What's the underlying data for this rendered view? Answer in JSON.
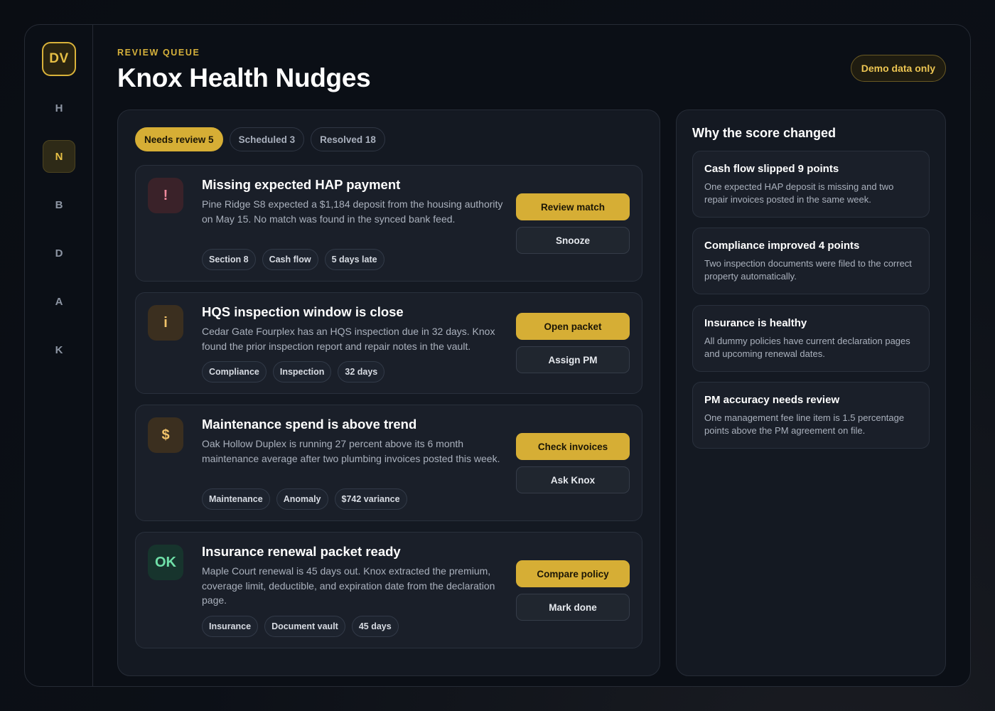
{
  "sidebar": {
    "logo": "DV",
    "items": [
      {
        "label": "H",
        "active": false
      },
      {
        "label": "N",
        "active": true
      },
      {
        "label": "B",
        "active": false
      },
      {
        "label": "D",
        "active": false
      },
      {
        "label": "A",
        "active": false
      },
      {
        "label": "K",
        "active": false
      }
    ]
  },
  "header": {
    "eyebrow": "REVIEW QUEUE",
    "title": "Knox Health Nudges",
    "badge": "Demo data only"
  },
  "tabs": [
    {
      "label": "Needs review 5",
      "active": true
    },
    {
      "label": "Scheduled 3",
      "active": false
    },
    {
      "label": "Resolved 18",
      "active": false
    }
  ],
  "nudges": [
    {
      "icon": "!",
      "icon_name": "alert-icon",
      "title": "Missing expected HAP payment",
      "body": "Pine Ridge S8 expected a $1,184 deposit from the housing authority on May 15. No match was found in the synced bank feed.",
      "tags": [
        "Section 8",
        "Cash flow",
        "5 days late"
      ],
      "primary": "Review match",
      "secondary": "Snooze"
    },
    {
      "icon": "i",
      "icon_name": "info-icon",
      "title": "HQS inspection window is close",
      "body": "Cedar Gate Fourplex has an HQS inspection due in 32 days. Knox found the prior inspection report and repair notes in the vault.",
      "tags": [
        "Compliance",
        "Inspection",
        "32 days"
      ],
      "primary": "Open packet",
      "secondary": "Assign PM"
    },
    {
      "icon": "$",
      "icon_name": "dollar-icon",
      "title": "Maintenance spend is above trend",
      "body": "Oak Hollow Duplex is running 27 percent above its 6 month maintenance average after two plumbing invoices posted this week.",
      "tags": [
        "Maintenance",
        "Anomaly",
        "$742 variance"
      ],
      "primary": "Check invoices",
      "secondary": "Ask Knox"
    },
    {
      "icon": "OK",
      "icon_name": "ok-icon",
      "title": "Insurance renewal packet ready",
      "body": "Maple Court renewal is 45 days out. Knox extracted the premium, coverage limit, deductible, and expiration date from the declaration page.",
      "tags": [
        "Insurance",
        "Document vault",
        "45 days"
      ],
      "primary": "Compare policy",
      "secondary": "Mark done"
    }
  ],
  "score_panel": {
    "title": "Why the score changed",
    "reasons": [
      {
        "title": "Cash flow slipped 9 points",
        "body": "One expected HAP deposit is missing and two repair invoices posted in the same week."
      },
      {
        "title": "Compliance improved 4 points",
        "body": "Two inspection documents were filed to the correct property automatically."
      },
      {
        "title": "Insurance is healthy",
        "body": "All dummy policies have current declaration pages and upcoming renewal dates."
      },
      {
        "title": "PM accuracy needs review",
        "body": "One management fee line item is 1.5 percentage points above the PM agreement on file."
      }
    ]
  },
  "colors": {
    "accent": "#d6ae35",
    "background": "#0b0f16",
    "panel": "#141922",
    "card": "#1a1f29"
  }
}
